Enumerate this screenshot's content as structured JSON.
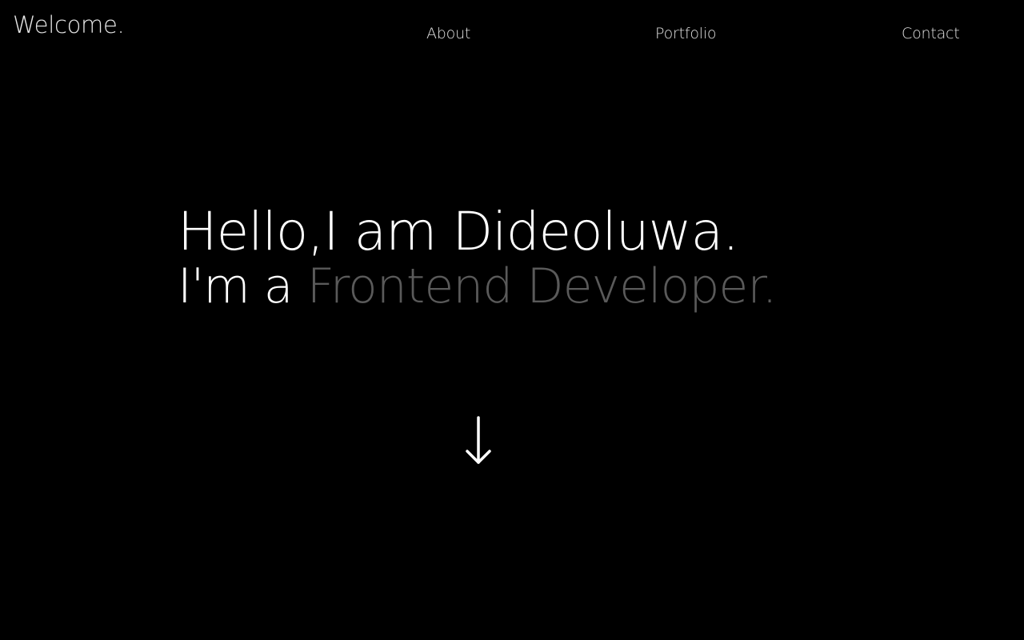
{
  "header": {
    "brand": "Welcome.",
    "nav": {
      "about": "About",
      "portfolio": "Portfolio",
      "contact": "Contact"
    }
  },
  "hero": {
    "greeting": "Hello,I am Dideoluwa.",
    "role_prefix": "I'm a ",
    "role_highlight": "Frontend Developer."
  },
  "colors": {
    "background": "#000000",
    "text": "#ffffff",
    "highlight": "#5a5a5a"
  },
  "icons": {
    "scroll": "arrow-down-icon"
  }
}
